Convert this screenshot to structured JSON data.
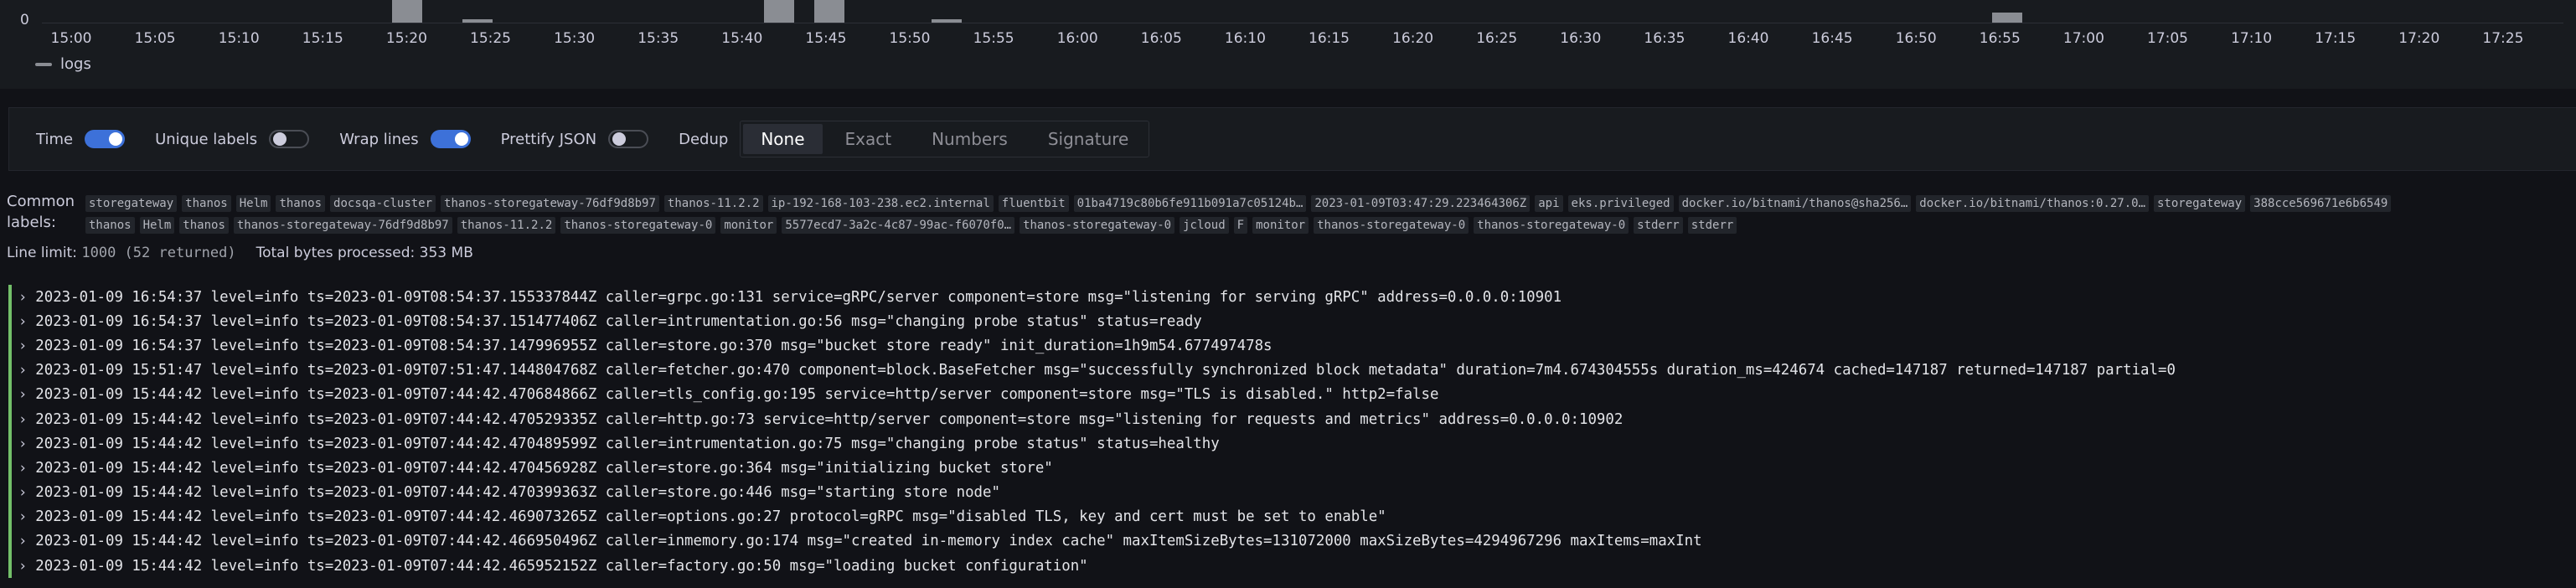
{
  "histogram": {
    "y_tick": "0",
    "x_ticks": [
      "15:00",
      "15:05",
      "15:10",
      "15:15",
      "15:20",
      "15:25",
      "15:30",
      "15:35",
      "15:40",
      "15:45",
      "15:50",
      "15:55",
      "16:00",
      "16:05",
      "16:10",
      "16:15",
      "16:20",
      "16:25",
      "16:30",
      "16:35",
      "16:40",
      "16:45",
      "16:50",
      "16:55",
      "17:00",
      "17:05",
      "17:10",
      "17:15",
      "17:20",
      "17:25"
    ],
    "legend": "logs",
    "colors": {
      "bar": "#8a8d93"
    }
  },
  "controls": {
    "time": {
      "label": "Time",
      "on": true
    },
    "unique_labels": {
      "label": "Unique labels",
      "on": false
    },
    "wrap_lines": {
      "label": "Wrap lines",
      "on": true
    },
    "prettify_json": {
      "label": "Prettify JSON",
      "on": false
    },
    "dedup": {
      "label": "Dedup",
      "options": [
        "None",
        "Exact",
        "Numbers",
        "Signature"
      ],
      "selected": "None"
    }
  },
  "common_labels": {
    "title_line1": "Common",
    "title_line2": "labels:",
    "row1": [
      "storegateway",
      "thanos",
      "Helm",
      "thanos",
      "docsqa-cluster",
      "thanos-storegateway-76df9d8b97",
      "thanos-11.2.2",
      "ip-192-168-103-238.ec2.internal",
      "fluentbit",
      "01ba4719c80b6fe911b091a7c05124b…",
      "2023-01-09T03:47:29.223464306Z",
      "api",
      "eks.privileged",
      "docker.io/bitnami/thanos@sha256…",
      "docker.io/bitnami/thanos:0.27.0…",
      "storegateway",
      "388cce569671e6b6549"
    ],
    "row2": [
      "thanos",
      "Helm",
      "thanos",
      "thanos-storegateway-76df9d8b97",
      "thanos-11.2.2",
      "thanos-storegateway-0",
      "monitor",
      "5577ecd7-3a2c-4c87-99ac-f6070f0…",
      "thanos-storegateway-0",
      "jcloud",
      "F",
      "monitor",
      "thanos-storegateway-0",
      "thanos-storegateway-0",
      "stderr",
      "stderr"
    ]
  },
  "meta": {
    "line_limit_label": "Line limit:",
    "line_limit_value": "1000 (52 returned)",
    "bytes_label": "Total bytes processed:",
    "bytes_value": "353 MB"
  },
  "logs": [
    "2023-01-09 16:54:37 level=info ts=2023-01-09T08:54:37.155337844Z caller=grpc.go:131 service=gRPC/server component=store msg=\"listening for serving gRPC\" address=0.0.0.0:10901",
    "2023-01-09 16:54:37 level=info ts=2023-01-09T08:54:37.151477406Z caller=intrumentation.go:56 msg=\"changing probe status\" status=ready",
    "2023-01-09 16:54:37 level=info ts=2023-01-09T08:54:37.147996955Z caller=store.go:370 msg=\"bucket store ready\" init_duration=1h9m54.677497478s",
    "2023-01-09 15:51:47 level=info ts=2023-01-09T07:51:47.144804768Z caller=fetcher.go:470 component=block.BaseFetcher msg=\"successfully synchronized block metadata\" duration=7m4.674304555s duration_ms=424674 cached=147187 returned=147187 partial=0",
    "2023-01-09 15:44:42 level=info ts=2023-01-09T07:44:42.470684866Z caller=tls_config.go:195 service=http/server component=store msg=\"TLS is disabled.\" http2=false",
    "2023-01-09 15:44:42 level=info ts=2023-01-09T07:44:42.470529335Z caller=http.go:73 service=http/server component=store msg=\"listening for requests and metrics\" address=0.0.0.0:10902",
    "2023-01-09 15:44:42 level=info ts=2023-01-09T07:44:42.470489599Z caller=intrumentation.go:75 msg=\"changing probe status\" status=healthy",
    "2023-01-09 15:44:42 level=info ts=2023-01-09T07:44:42.470456928Z caller=store.go:364 msg=\"initializing bucket store\"",
    "2023-01-09 15:44:42 level=info ts=2023-01-09T07:44:42.470399363Z caller=store.go:446 msg=\"starting store node\"",
    "2023-01-09 15:44:42 level=info ts=2023-01-09T07:44:42.469073265Z caller=options.go:27 protocol=gRPC msg=\"disabled TLS, key and cert must be set to enable\"",
    "2023-01-09 15:44:42 level=info ts=2023-01-09T07:44:42.466950496Z caller=inmemory.go:174 msg=\"created in-memory index cache\" maxItemSizeBytes=131072000 maxSizeBytes=4294967296 maxItems=maxInt",
    "2023-01-09 15:44:42 level=info ts=2023-01-09T07:44:42.465952152Z caller=factory.go:50 msg=\"loading bucket configuration\""
  ]
}
